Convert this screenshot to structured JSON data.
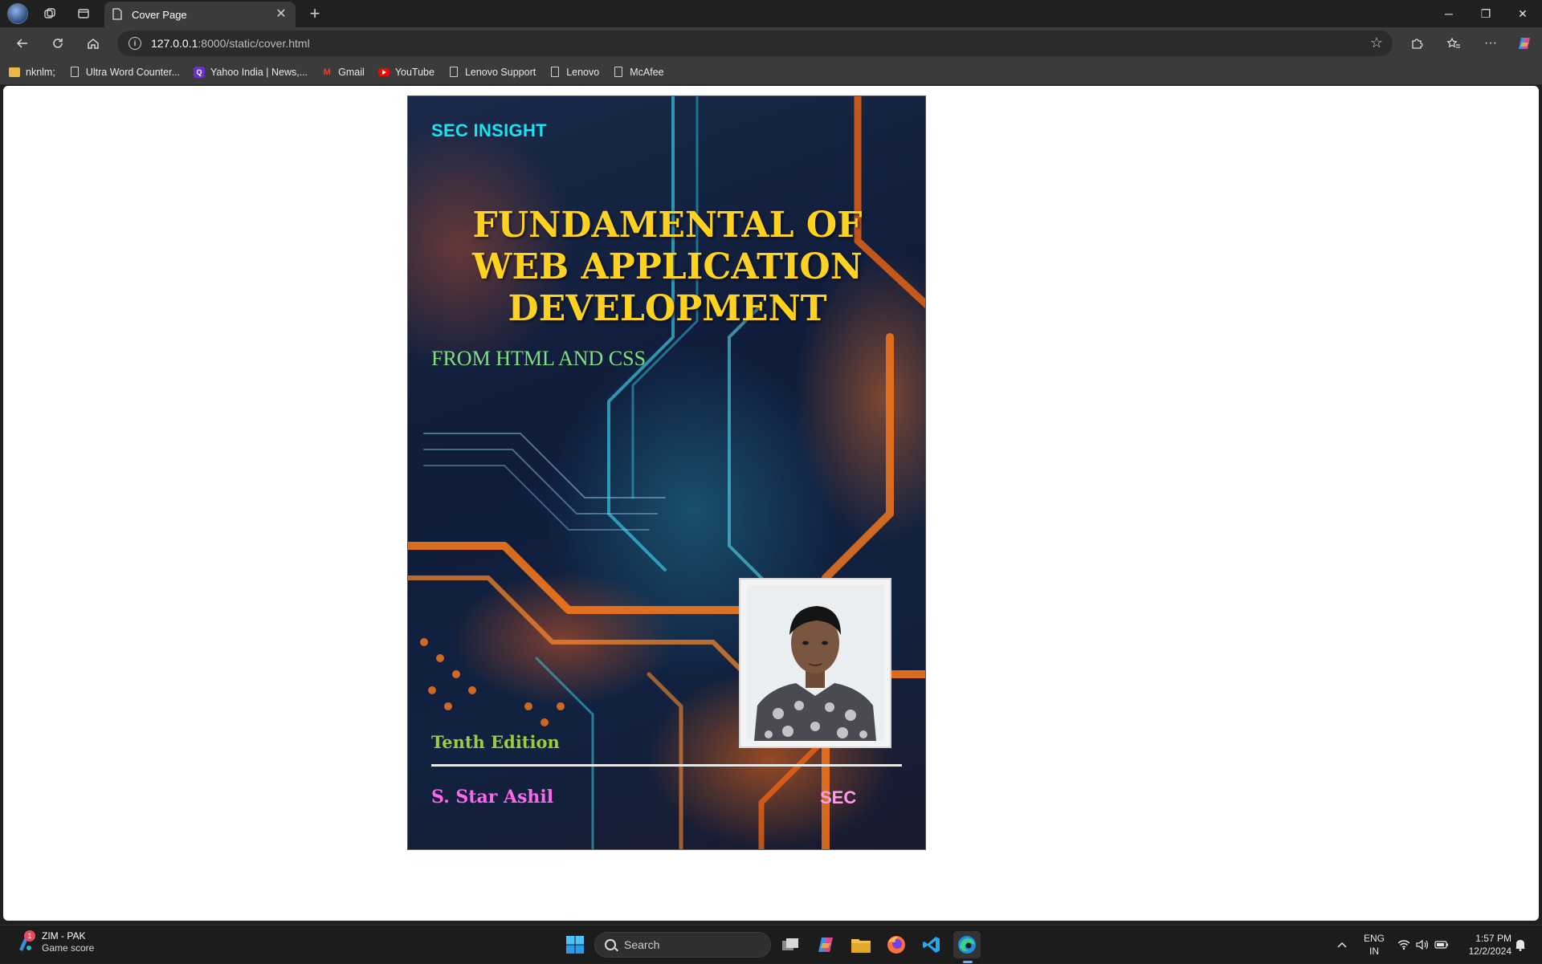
{
  "browser": {
    "tab_title": "Cover Page",
    "url_host": "127.0.0.1",
    "url_rest": ":8000/static/cover.html",
    "bookmarks": [
      {
        "label": "nknlm;",
        "icon": "folder-icon"
      },
      {
        "label": "Ultra Word Counter...",
        "icon": "page-icon"
      },
      {
        "label": "Yahoo India | News,...",
        "icon": "yahoo-icon"
      },
      {
        "label": "Gmail",
        "icon": "gmail-icon"
      },
      {
        "label": "YouTube",
        "icon": "youtube-icon"
      },
      {
        "label": "Lenovo Support",
        "icon": "page-icon"
      },
      {
        "label": "Lenovo",
        "icon": "page-icon"
      },
      {
        "label": "McAfee",
        "icon": "page-icon"
      }
    ]
  },
  "cover": {
    "brand": "SEC INSIGHT",
    "title_lines": [
      "FUNDAMENTAL OF",
      "WEB APPLICATION",
      "DEVELOPMENT"
    ],
    "subtitle": "FROM HTML AND CSS",
    "edition": "Tenth Edition",
    "author": "S. Star Ashil",
    "publisher": "SEC",
    "colors": {
      "brand": "#18e4f0",
      "title": "#ffd21f",
      "subtitle": "#7fe07f",
      "edition": "#9ccc3c",
      "author": "#ff66ee",
      "publisher": "#ff9cf0"
    }
  },
  "taskbar": {
    "weather_title": "ZIM - PAK",
    "weather_subtitle": "Game score",
    "weather_badge": "1",
    "search_placeholder": "Search",
    "language_line1": "ENG",
    "language_line2": "IN",
    "time": "1:57 PM",
    "date": "12/2/2024"
  }
}
